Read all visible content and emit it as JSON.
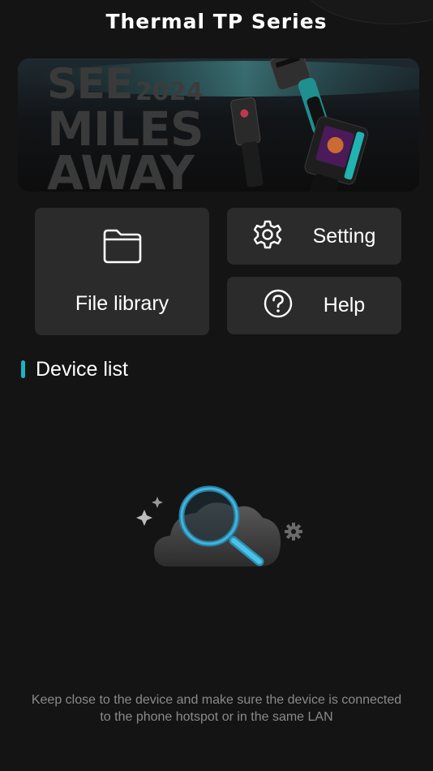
{
  "header": {
    "title": "Thermal TP Series"
  },
  "banner": {
    "line1": "SEE",
    "year": "2024",
    "line2": "MILES",
    "line3": "AWAY"
  },
  "actions": {
    "file_library": "File library",
    "setting": "Setting",
    "help": "Help"
  },
  "devices": {
    "section_title": "Device list",
    "empty_hint": "Keep close to the device and make sure the device is connected to the phone hotspot or in the same LAN"
  },
  "colors": {
    "accent": "#19b4c0",
    "background": "#141414",
    "card": "#2b2b2b",
    "hint_text": "#8a8a8a"
  },
  "icons": [
    "folder-icon",
    "gear-icon",
    "question-circle-icon",
    "magnifier-cloud-icon"
  ]
}
